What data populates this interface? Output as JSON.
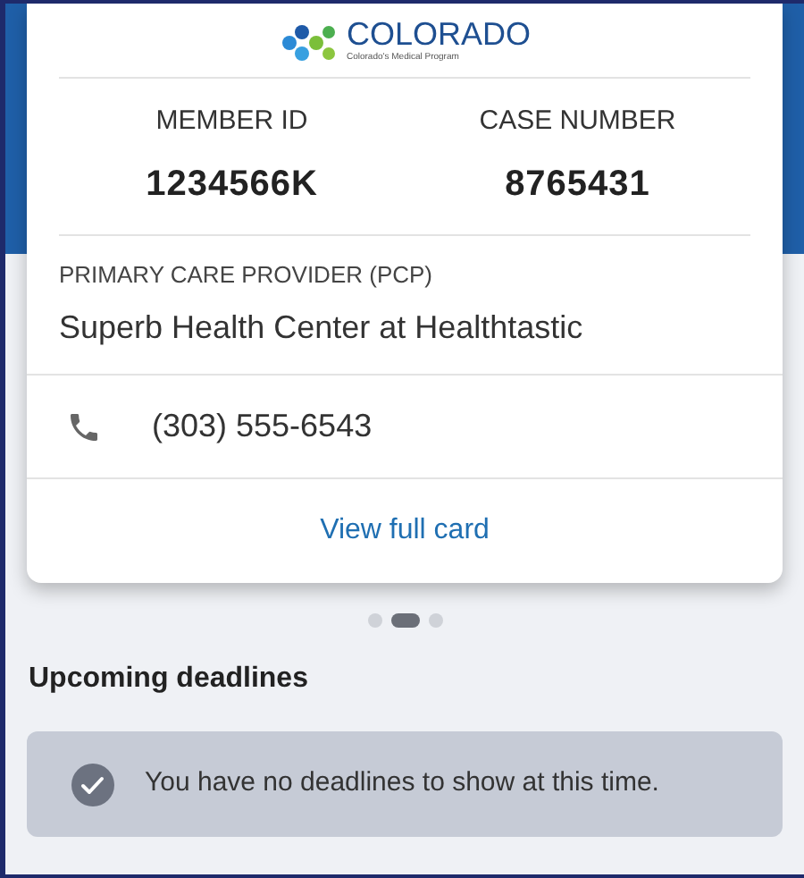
{
  "card": {
    "logo": {
      "name": "COLORADO",
      "tagline": "Colorado's Medical Program"
    },
    "member_id": {
      "label": "MEMBER ID",
      "value": "1234566K"
    },
    "case_number": {
      "label": "CASE NUMBER",
      "value": "8765431"
    },
    "pcp": {
      "label": "PRIMARY CARE PROVIDER (PCP)",
      "value": "Superb Health Center at Healthtastic"
    },
    "phone": "(303) 555-6543",
    "link": "View full card"
  },
  "pager": [
    {
      "selected": false
    },
    {
      "selected": true
    },
    {
      "selected": false
    }
  ],
  "deadlines": {
    "title": "Upcoming deadlines",
    "message": "You have no deadlines to show at this time."
  }
}
